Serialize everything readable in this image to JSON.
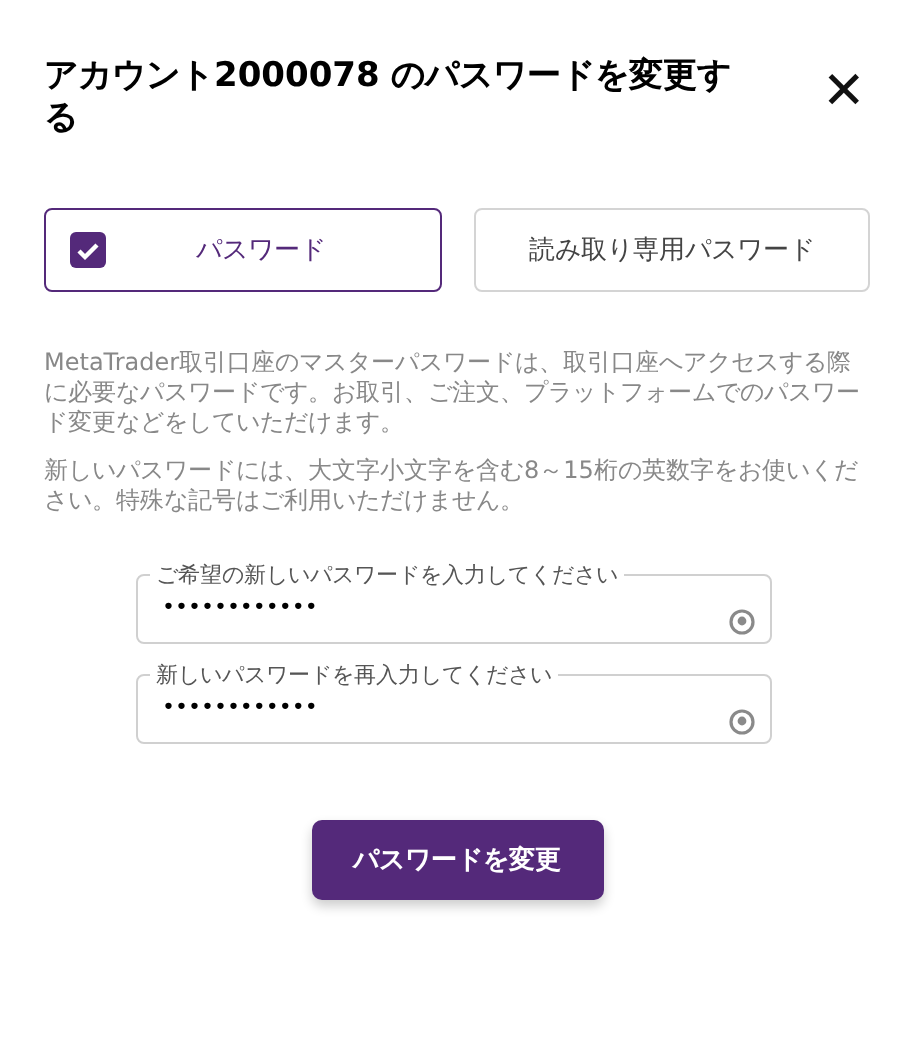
{
  "dialog": {
    "title": "アカウント2000078 のパスワードを変更する",
    "close": "✕"
  },
  "options": [
    {
      "label": "パスワード",
      "selected": true
    },
    {
      "label": "読み取り専用パスワード",
      "selected": false
    }
  ],
  "paragraphs": [
    "MetaTrader取引口座のマスターパスワードは、取引口座へアクセスする際に必要なパスワードです。お取引、ご注文、プラットフォームでのパスワード変更などをしていただけます。",
    "新しいパスワードには、大文字小文字を含む8～15桁の英数字をお使いください。特殊な記号はご利用いただけません。"
  ],
  "fields": [
    {
      "label": "ご希望の新しいパスワードを入力してください",
      "value": "••••••••••••"
    },
    {
      "label": "新しいパスワードを再入力してください",
      "value": "••••••••••••"
    }
  ],
  "submit": "パスワードを変更"
}
